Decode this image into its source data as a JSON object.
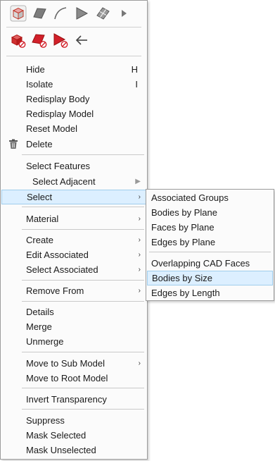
{
  "toolbar": {
    "row1": [
      {
        "icon": "solid-cube-icon"
      },
      {
        "icon": "surface-face-icon"
      },
      {
        "icon": "curve-edge-icon"
      },
      {
        "icon": "flag-point-icon"
      },
      {
        "icon": "surface-grid-icon"
      },
      {
        "icon": "triangle-right-icon"
      }
    ],
    "row2": [
      {
        "icon": "delete-solid-icon"
      },
      {
        "icon": "delete-surface-icon"
      },
      {
        "icon": "delete-flag-icon"
      },
      {
        "icon": "back-arrow-icon"
      }
    ]
  },
  "menu": {
    "hide": {
      "label": "Hide",
      "shortcut": "H"
    },
    "isolate": {
      "label": "Isolate",
      "shortcut": "I"
    },
    "redisplay_body": "Redisplay Body",
    "redisplay_model": "Redisplay Model",
    "reset_model": "Reset Model",
    "delete": "Delete",
    "select_features": "Select Features",
    "select_adjacent": "Select Adjacent",
    "select": "Select",
    "material": "Material",
    "create": "Create",
    "edit_associated": "Edit Associated",
    "select_associated": "Select Associated",
    "remove_from": "Remove From",
    "details": "Details",
    "merge": "Merge",
    "unmerge": "Unmerge",
    "move_to_sub_model": "Move to Sub Model",
    "move_to_root_model": "Move to Root Model",
    "invert_transparency": "Invert Transparency",
    "suppress": "Suppress",
    "mask_selected": "Mask Selected",
    "mask_unselected": "Mask Unselected"
  },
  "submenu": {
    "associated_groups": "Associated Groups",
    "bodies_by_plane": "Bodies by Plane",
    "faces_by_plane": "Faces by Plane",
    "edges_by_plane": "Edges by Plane",
    "overlapping_cad_faces": "Overlapping CAD Faces",
    "bodies_by_size": "Bodies by Size",
    "edges_by_length": "Edges by Length"
  },
  "colors": {
    "highlight_bg": "#dcefff",
    "highlight_border": "#9fcdec",
    "delete_red": "#d2202a"
  }
}
